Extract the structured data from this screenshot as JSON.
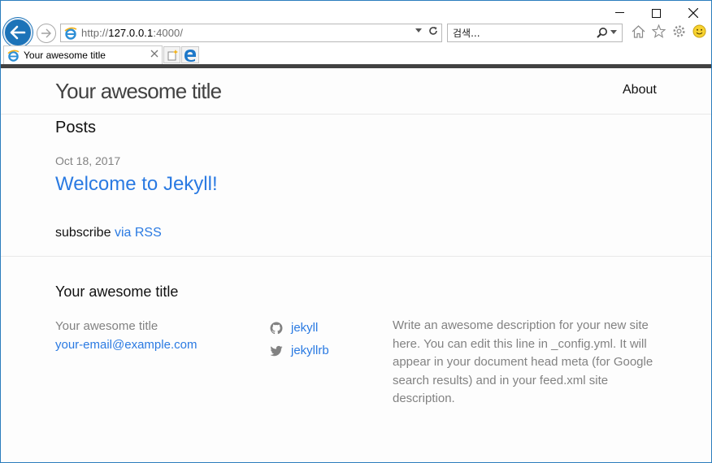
{
  "browser": {
    "address_url_prefix": "http://",
    "address_url_host": "127.0.0.1",
    "address_url_rest": ":4000/",
    "search_placeholder": "검색...",
    "tab_title": "Your awesome title",
    "accent_color": "#1c73b8"
  },
  "site": {
    "title": "Your awesome title",
    "nav": [
      {
        "label": "About"
      }
    ],
    "link_color": "#2a7ae2"
  },
  "home": {
    "heading": "Posts",
    "posts": [
      {
        "date": "Oct 18, 2017",
        "title": "Welcome to Jekyll!"
      }
    ],
    "subscribe_prefix": "subscribe",
    "subscribe_link": "via RSS"
  },
  "footer": {
    "heading": "Your awesome title",
    "name": "Your awesome title",
    "email": "your-email@example.com",
    "github_user": "jekyll",
    "twitter_user": "jekyllrb",
    "description": "Write an awesome description for your new site here. You can edit this line in _config.yml. It will appear in your document head meta (for Google search results) and in your feed.xml site description."
  }
}
